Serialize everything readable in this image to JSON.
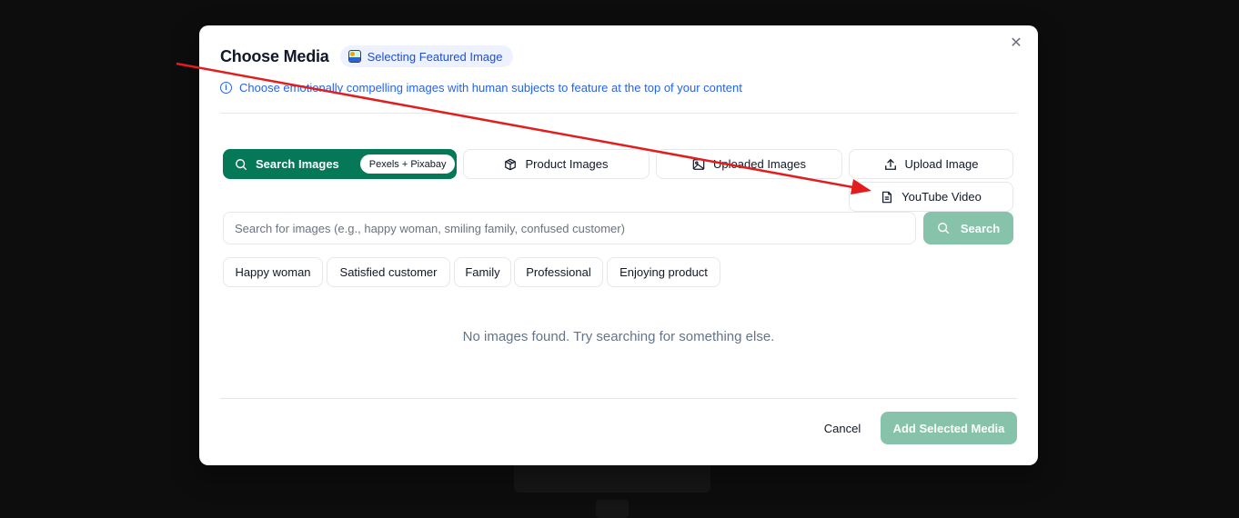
{
  "background": {
    "cta_label": ""
  },
  "modal": {
    "title": "Choose Media",
    "badge": "Selecting Featured Image",
    "hint": "Choose emotionally compelling images with human subjects to feature at the top of your content",
    "close_icon": "close-icon"
  },
  "tabs": {
    "search_images": "Search Images",
    "search_images_pill": "Pexels + Pixabay",
    "product_images": "Product Images",
    "uploaded_images": "Uploaded Images",
    "upload_image": "Upload Image",
    "youtube_video": "YouTube Video"
  },
  "search": {
    "placeholder": "Search for images (e.g., happy woman, smiling family, confused customer)",
    "value": "",
    "button": "Search"
  },
  "suggestions": [
    "Happy woman",
    "Satisfied customer",
    "Family",
    "Professional",
    "Enjoying product"
  ],
  "empty_state": "No images found. Try searching for something else.",
  "footer": {
    "cancel": "Cancel",
    "add": "Add Selected Media"
  },
  "colors": {
    "accent": "#047857",
    "accent_disabled": "#86c3aa",
    "link": "#2563eb",
    "annotation_arrow": "#e11d1d"
  }
}
